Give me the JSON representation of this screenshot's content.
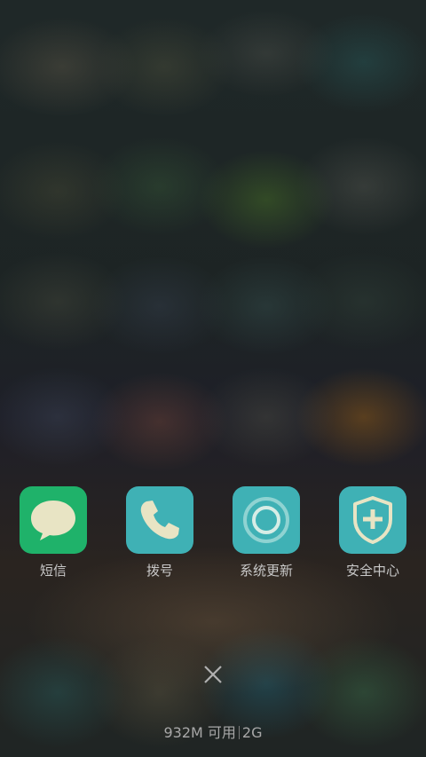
{
  "shortcuts": [
    {
      "label": "短信",
      "icon": "message-bubble-icon",
      "color": "#1fb26a"
    },
    {
      "label": "拨号",
      "icon": "phone-handset-icon",
      "color": "#3fb1b5"
    },
    {
      "label": "系统更新",
      "icon": "update-ring-icon",
      "color": "#3fb1b5"
    },
    {
      "label": "安全中心",
      "icon": "shield-plus-icon",
      "color": "#3fb1b5"
    }
  ],
  "close_icon": "close-icon",
  "status": {
    "memory": "932M 可用",
    "network": "2G"
  }
}
